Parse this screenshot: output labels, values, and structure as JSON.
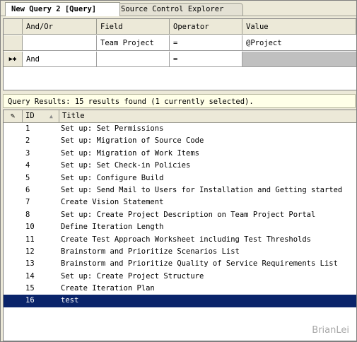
{
  "tabs": [
    {
      "label": "New Query 2 [Query]"
    },
    {
      "label": "Source Control Explorer"
    }
  ],
  "criteria": {
    "headers": {
      "and_or": "And/Or",
      "field": "Field",
      "operator": "Operator",
      "value": "Value"
    },
    "rows": [
      {
        "marker": "",
        "and_or": "",
        "field": "Team Project",
        "operator": "=",
        "value": "@Project"
      },
      {
        "marker": "▶✱",
        "and_or": "And",
        "field": "",
        "operator": "=",
        "value": ""
      }
    ]
  },
  "results_status": "Query Results: 15 results found (1 currently selected).",
  "results": {
    "headers": {
      "edit": "✎",
      "id": "ID",
      "sort": "▲",
      "title": "Title"
    },
    "items": [
      {
        "id": "1",
        "title": "Set up: Set Permissions"
      },
      {
        "id": "2",
        "title": "Set up: Migration of Source Code"
      },
      {
        "id": "3",
        "title": "Set up: Migration of Work Items"
      },
      {
        "id": "4",
        "title": "Set up: Set Check-in Policies"
      },
      {
        "id": "5",
        "title": "Set up: Configure Build"
      },
      {
        "id": "6",
        "title": "Set up: Send Mail to Users for Installation and Getting started"
      },
      {
        "id": "7",
        "title": "Create Vision Statement"
      },
      {
        "id": "8",
        "title": "Set up: Create Project Description on Team Project Portal"
      },
      {
        "id": "10",
        "title": "Define Iteration Length"
      },
      {
        "id": "11",
        "title": "Create Test Approach Worksheet including Test Thresholds"
      },
      {
        "id": "12",
        "title": "Brainstorm and Prioritize Scenarios List"
      },
      {
        "id": "13",
        "title": "Brainstorm and Prioritize Quality of Service Requirements List"
      },
      {
        "id": "14",
        "title": "Set up: Create Project Structure"
      },
      {
        "id": "15",
        "title": "Create Iteration Plan"
      },
      {
        "id": "16",
        "title": "test"
      }
    ]
  },
  "selected_color": "#0a246a",
  "watermark": "BrianLei"
}
